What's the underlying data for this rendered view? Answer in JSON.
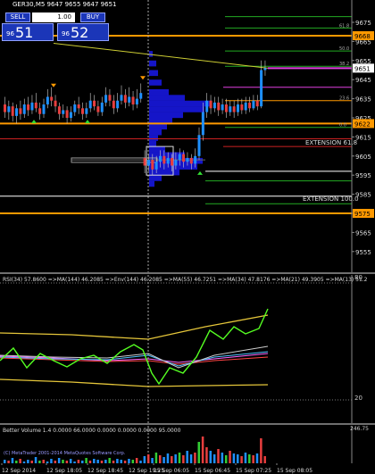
{
  "symbol_line": "GER30,M5  9647 9655 9647 9651",
  "trade": {
    "sell_label": "SELL",
    "buy_label": "BUY",
    "lots": "1.00",
    "bid_pre": "96",
    "bid_big": "51",
    "ask_pre": "96",
    "ask_big": "52"
  },
  "colors": {
    "bull": "#1e90ff",
    "bear": "#e83e3e",
    "profile": "#1515c8",
    "orange": "#ff9900",
    "magenta": "#e040e0",
    "green_line": "#22aa22",
    "yellow_line": "#cccc33"
  },
  "price_axis": {
    "ticks": [
      "9675",
      "9665",
      "9655",
      "9645",
      "9635",
      "9625",
      "9615",
      "9605",
      "9595",
      "9585",
      "9575",
      "9565",
      "9555"
    ],
    "current": "9651",
    "orange_top": "9668",
    "orange_mid": "9622",
    "orange_bottom": "9575",
    "fib_labels": [
      "61.8",
      "50.0",
      "38.2",
      "23.6",
      "0.0"
    ]
  },
  "annotations": {
    "ext_618": "EXTENSION 61.8",
    "ext_100": "EXTENSION 100.0"
  },
  "rsi": {
    "header": "RSI(34) 57.8600  =>MA(144) 46.2085  =>Env(144) 46.2085  =>MA(55) 46.7251  =>MA(34) 47.8176  =>MA(21) 49.3905  =>MA(13) 51.2",
    "axis": [
      "80",
      "20"
    ]
  },
  "volume": {
    "header": "Better Volume 1.4  0.0000  66.0000  0.0000  0.0000  0.0000  95.0000",
    "axis_top": "246.75",
    "watermark": "(C) MetaTrader 2001-2014 MetaQuotes Software Corp."
  },
  "time_axis": [
    "12 Sep 2014",
    "12 Sep 18:05",
    "12 Sep 18:45",
    "12 Sep 19:25",
    "15 Sep 06:05",
    "15 Sep 06:45",
    "15 Sep 07:25",
    "15 Sep 08:05"
  ]
}
